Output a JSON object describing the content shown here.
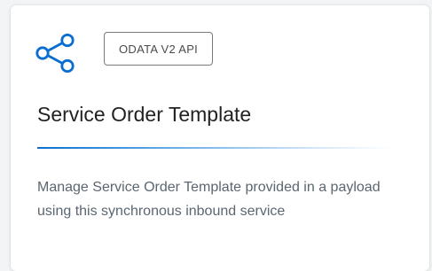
{
  "card": {
    "icon": "share-icon",
    "badge_label": "ODATA V2 API",
    "title": "Service Order Template",
    "description": "Manage Service Order Template provided in a payload using this synchronous inbound service"
  },
  "colors": {
    "accent": "#0a6ed1",
    "title_text": "#222222",
    "description_text": "#5b6670",
    "badge_border": "#7a7a7a"
  }
}
